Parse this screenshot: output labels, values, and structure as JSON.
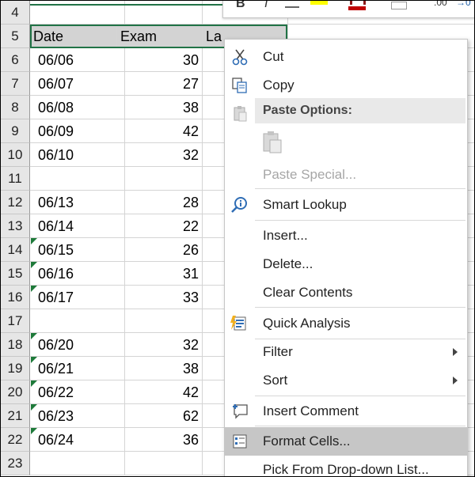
{
  "sheet": {
    "header_row": {
      "row": "5",
      "a": "Date",
      "b": "Exam",
      "c": "La"
    },
    "rows": [
      {
        "num": "4",
        "date": "",
        "exam": "",
        "flag": false
      },
      {
        "num": "6",
        "date": "06/06",
        "exam": "30",
        "flag": false
      },
      {
        "num": "7",
        "date": "06/07",
        "exam": "27",
        "flag": false
      },
      {
        "num": "8",
        "date": "06/08",
        "exam": "38",
        "flag": false
      },
      {
        "num": "9",
        "date": "06/09",
        "exam": "42",
        "flag": false
      },
      {
        "num": "10",
        "date": "06/10",
        "exam": "32",
        "flag": false
      },
      {
        "num": "11",
        "date": "",
        "exam": "",
        "flag": false
      },
      {
        "num": "12",
        "date": "06/13",
        "exam": "28",
        "flag": false
      },
      {
        "num": "13",
        "date": "06/14",
        "exam": "22",
        "flag": false
      },
      {
        "num": "14",
        "date": "06/15",
        "exam": "26",
        "flag": true
      },
      {
        "num": "15",
        "date": "06/16",
        "exam": "31",
        "flag": true
      },
      {
        "num": "16",
        "date": "06/17",
        "exam": "33",
        "flag": true
      },
      {
        "num": "17",
        "date": "",
        "exam": "",
        "flag": false
      },
      {
        "num": "18",
        "date": "06/20",
        "exam": "32",
        "flag": true
      },
      {
        "num": "19",
        "date": "06/21",
        "exam": "38",
        "flag": true
      },
      {
        "num": "20",
        "date": "06/22",
        "exam": "42",
        "flag": true
      },
      {
        "num": "21",
        "date": "06/23",
        "exam": "62",
        "flag": true
      },
      {
        "num": "22",
        "date": "06/24",
        "exam": "36",
        "flag": true
      },
      {
        "num": "23",
        "date": "",
        "exam": "",
        "flag": false
      }
    ]
  },
  "mini_toolbar": {
    "bold": "B",
    "italic": "I",
    "decimals": ".00",
    "arrow": "→0"
  },
  "context_menu": {
    "cut": "Cut",
    "copy": "Copy",
    "paste_options": "Paste Options:",
    "paste_special": "Paste Special...",
    "smart_lookup": "Smart Lookup",
    "insert": "Insert...",
    "delete": "Delete...",
    "clear_contents": "Clear Contents",
    "quick_analysis": "Quick Analysis",
    "filter": "Filter",
    "sort": "Sort",
    "insert_comment": "Insert Comment",
    "format_cells": "Format Cells...",
    "pick_list": "Pick From Drop-down List..."
  },
  "colors": {
    "accent": "#217346",
    "highlight": "#c6c6c6",
    "header_fill": "#d3d3d3"
  }
}
